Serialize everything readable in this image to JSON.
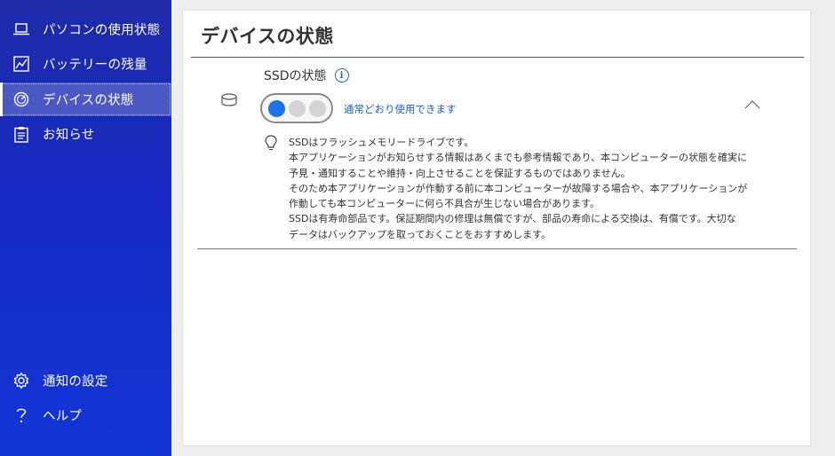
{
  "sidebar": {
    "items": [
      {
        "label": "パソコンの使用状態",
        "icon": "laptop-icon"
      },
      {
        "label": "バッテリーの残量",
        "icon": "battery-chart-icon"
      },
      {
        "label": "デバイスの状態",
        "icon": "gauge-icon",
        "active": true
      },
      {
        "label": "お知らせ",
        "icon": "clipboard-icon"
      }
    ],
    "bottom_items": [
      {
        "label": "通知の設定",
        "icon": "gear-icon"
      },
      {
        "label": "ヘルプ",
        "icon": "question-icon"
      }
    ]
  },
  "main": {
    "title": "デバイスの状態",
    "section": {
      "title": "SSDの状態",
      "info_icon": "i",
      "status_text": "通常どおり使用できます",
      "status_level": "normal",
      "description": [
        "SSDはフラッシュメモリードライブです。",
        "本アプリケーションがお知らせする情報はあくまでも参考情報であり、本コンピューターの状態を確実に",
        "予見・通知することや維持・向上させることを保証するものではありません。",
        "そのため本アプリケーションが作動する前に本コンピューターが故障する場合や、本アプリケーションが",
        "作動しても本コンピューターに何ら不具合が生じない場合があります。",
        "SSDは有寿命部品です。保証期間内の修理は無償ですが、部品の寿命による交換は、有償です。大切な",
        "データはバックアップを取っておくことをおすすめします。"
      ]
    }
  },
  "colors": {
    "sidebar_top": "#1e2aa8",
    "sidebar_bottom": "#1236d6",
    "accent": "#1a73e8",
    "link": "#1a5fd1"
  }
}
